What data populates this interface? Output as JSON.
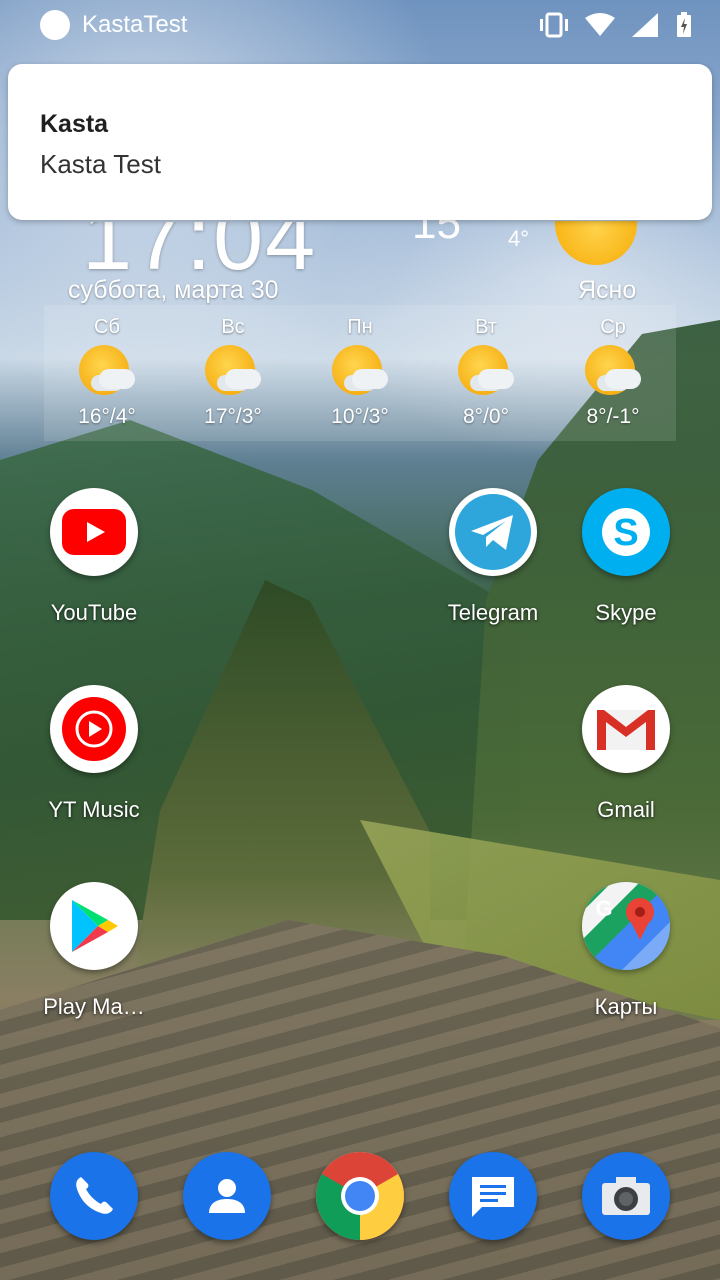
{
  "status_bar": {
    "notification_app_title": "KastaTest",
    "icons": [
      "vibrate-icon",
      "wifi-icon",
      "cellular-signal-icon",
      "battery-charging-icon"
    ]
  },
  "notification": {
    "app_name": "Kasta",
    "text": "Kasta Test"
  },
  "weather_widget": {
    "time": "17:04",
    "current_temp": "15°",
    "low_temp": "4°",
    "date": "суббота, марта 30",
    "condition": "Ясно",
    "forecast": [
      {
        "day": "Сб",
        "range": "16°/4°",
        "icon": "sun-cloud-icon"
      },
      {
        "day": "Вс",
        "range": "17°/3°",
        "icon": "sun-cloud-icon"
      },
      {
        "day": "Пн",
        "range": "10°/3°",
        "icon": "sun-cloud-icon"
      },
      {
        "day": "Вт",
        "range": "8°/0°",
        "icon": "sun-cloud-icon"
      },
      {
        "day": "Ср",
        "range": "8°/-1°",
        "icon": "sun-cloud-icon"
      }
    ]
  },
  "apps": [
    {
      "label": "YouTube",
      "icon": "youtube-icon"
    },
    {
      "label": "Telegram",
      "icon": "telegram-icon"
    },
    {
      "label": "Skype",
      "icon": "skype-icon"
    },
    {
      "label": "YT Music",
      "icon": "yt-music-icon"
    },
    {
      "label": "Gmail",
      "icon": "gmail-icon"
    },
    {
      "label": "Play Ma…",
      "icon": "play-store-icon"
    },
    {
      "label": "Карты",
      "icon": "maps-icon"
    }
  ],
  "dock": [
    "phone-icon",
    "contacts-icon",
    "chrome-icon",
    "messages-icon",
    "camera-icon"
  ],
  "colors": {
    "youtube_red": "#ff0000",
    "telegram_blue": "#2ea6dc",
    "skype_blue": "#00aff0",
    "dock_blue": "#1a73e8",
    "notification_bg": "#ffffff"
  }
}
